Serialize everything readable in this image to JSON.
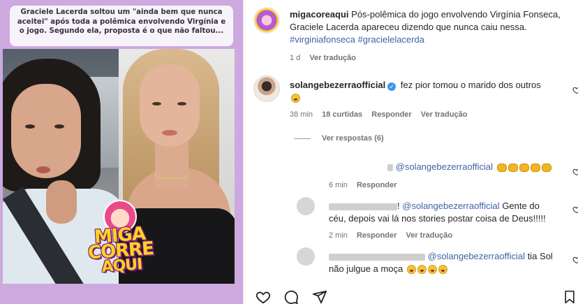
{
  "post_image": {
    "caption": "Graciele Lacerda soltou um \"ainda bem que nunca aceitei\" após toda a polêmica envolvendo Virgínia e o jogo. Segundo ela, proposta é o que não faltou...",
    "logo": {
      "line1": "MIGA",
      "line2": "CORRE",
      "line3": "AQUI"
    }
  },
  "post": {
    "username": "migacoreaqui",
    "text": "Pós-polêmica do jogo envolvendo Virgínia Fonseca, Graciele Lacerda apareceu dizendo que nunca caiu nessa.",
    "hashtags": "#virginiafonseca #gracielelacerda",
    "time": "1 d",
    "see_translation": "Ver tradução"
  },
  "comments": [
    {
      "username": "solangebezerraofficial",
      "verified": true,
      "text": "fez pior tomou o marido dos outros",
      "time": "38 min",
      "likes": "18 curtidas",
      "reply": "Responder",
      "see_translation": "Ver tradução",
      "view_replies": "Ver respostas (6)"
    }
  ],
  "replies": [
    {
      "mention": "@solangebezerraofficial",
      "time": "6 min",
      "reply": "Responder"
    },
    {
      "mention": "@solangebezerraofficial",
      "text_line1": "Gente do",
      "text_line2": "céu, depois vai lá nos stories postar coisa de Deus!!!!!",
      "text_prefix": "!",
      "time": "2 min",
      "reply": "Responder",
      "see_translation": "Ver tradução"
    },
    {
      "mention": "@solangebezerraofficial",
      "text_tail": "tia Sol",
      "text_line2": "não julgue a moça"
    }
  ],
  "icons": [
    "heart-icon",
    "comment-icon",
    "share-icon",
    "bookmark-icon",
    "verified-icon"
  ],
  "colors": {
    "link": "#3f63a8",
    "muted": "#737373",
    "verified": "#3897f0"
  }
}
